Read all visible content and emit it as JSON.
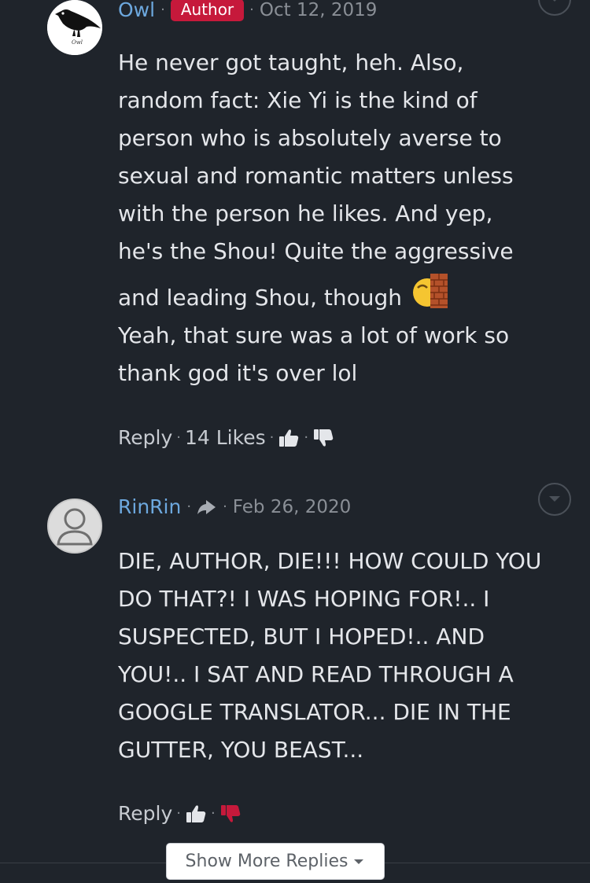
{
  "comments": [
    {
      "username": "Owl",
      "badge": "Author",
      "date": "Oct 12, 2019",
      "avatar_icon": "owl-logo",
      "avatar_text": "Owl",
      "paragraphs": [
        "He never got taught, heh. Also, random fact: Xie Yi is the kind of person who is absolutely averse to sexual and romantic matters unless with the person he likes. And yep, he's the Shou! Quite the aggressive and leading Shou, though",
        "Yeah, that sure was a lot of work so thank god it's over lol"
      ],
      "inline_emoji": "face-behind-brick-wall-emoji",
      "reply_label": "Reply",
      "likes_label": "14 Likes",
      "upvote_icon": "thumbs-up-icon",
      "downvote_icon": "thumbs-down-icon",
      "downvote_color": "#e4e6ea"
    },
    {
      "username": "RinRin",
      "date": "Feb 26, 2020",
      "avatar_icon": "default-user-avatar",
      "reply_indicator_icon": "reply-arrow-icon",
      "paragraphs": [
        "DIE, AUTHOR, DIE!!! HOW COULD YOU DO THAT?! I WAS HOPING FOR!.. I SUSPECTED, BUT I HOPED!.. AND YOU!.. I SAT AND READ THROUGH A GOOGLE TRANSLATOR... DIE IN THE GUTTER, YOU BEAST..."
      ],
      "reply_label": "Reply",
      "upvote_icon": "thumbs-up-icon",
      "downvote_icon": "thumbs-down-icon",
      "downvote_color": "#c6193b"
    }
  ],
  "show_more": {
    "label": "Show More Replies",
    "icon": "caret-down-icon"
  },
  "colors": {
    "background": "#1f242b",
    "username": "#6da8de",
    "author_badge": "#c6193b",
    "muted_text": "#8a8f96"
  }
}
